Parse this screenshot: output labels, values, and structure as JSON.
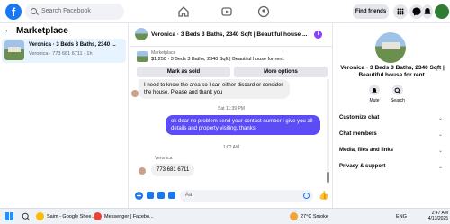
{
  "topbar": {
    "logo": "f",
    "search_placeholder": "Search Facebook",
    "find_friends": "Find friends",
    "icons": [
      "home-icon",
      "video-icon",
      "groups-icon",
      "menu-grid-icon",
      "messenger-icon",
      "bell-icon",
      "avatar"
    ]
  },
  "sidebar": {
    "title": "Marketplace",
    "listing": {
      "title": "Veronica · 3 Beds 3 Baths, 2340 ...",
      "subtitle": "Veronica · 773 681 6711 · 1h"
    }
  },
  "chat": {
    "header_title": "Veronica · 3 Beds 3 Baths, 2340 Sqft | Beautiful house ...",
    "marketplace_label": "Marketplace",
    "marketplace_detail": "$1,250 · 3 Beds 3 Baths, 2340 Sqft | Beautiful house for rent.",
    "mark_sold": "Mark as sold",
    "more_options": "More options",
    "messages": [
      {
        "type": "in",
        "text": "I need to know the area so I can either discard or consider the house. Please and thank you"
      },
      {
        "type": "time",
        "text": "Sat 11:39 PM"
      },
      {
        "type": "out",
        "text": "ok dear no problem send your contact number i give you all details and property visiting. thanks"
      },
      {
        "type": "time",
        "text": "1:02 AM"
      },
      {
        "type": "sender",
        "text": "Veronica"
      },
      {
        "type": "in",
        "text": "773 681 6711"
      }
    ],
    "composer_placeholder": "Aa"
  },
  "rightpanel": {
    "title": "Veronica · 3 Beds 3 Baths, 2340 Sqft | Beautiful house for rent.",
    "actions": [
      "Mute",
      "Search"
    ],
    "rows": [
      "Customize chat",
      "Chat members",
      "Media, files and links",
      "Privacy & support"
    ]
  },
  "taskbar": {
    "items": [
      "Saim - Google Shee...",
      "Messenger | Facebo..."
    ],
    "weather": "27°C  Smoke",
    "lang": "ENG",
    "time": "2:47 AM",
    "date": "4/13/2025"
  }
}
